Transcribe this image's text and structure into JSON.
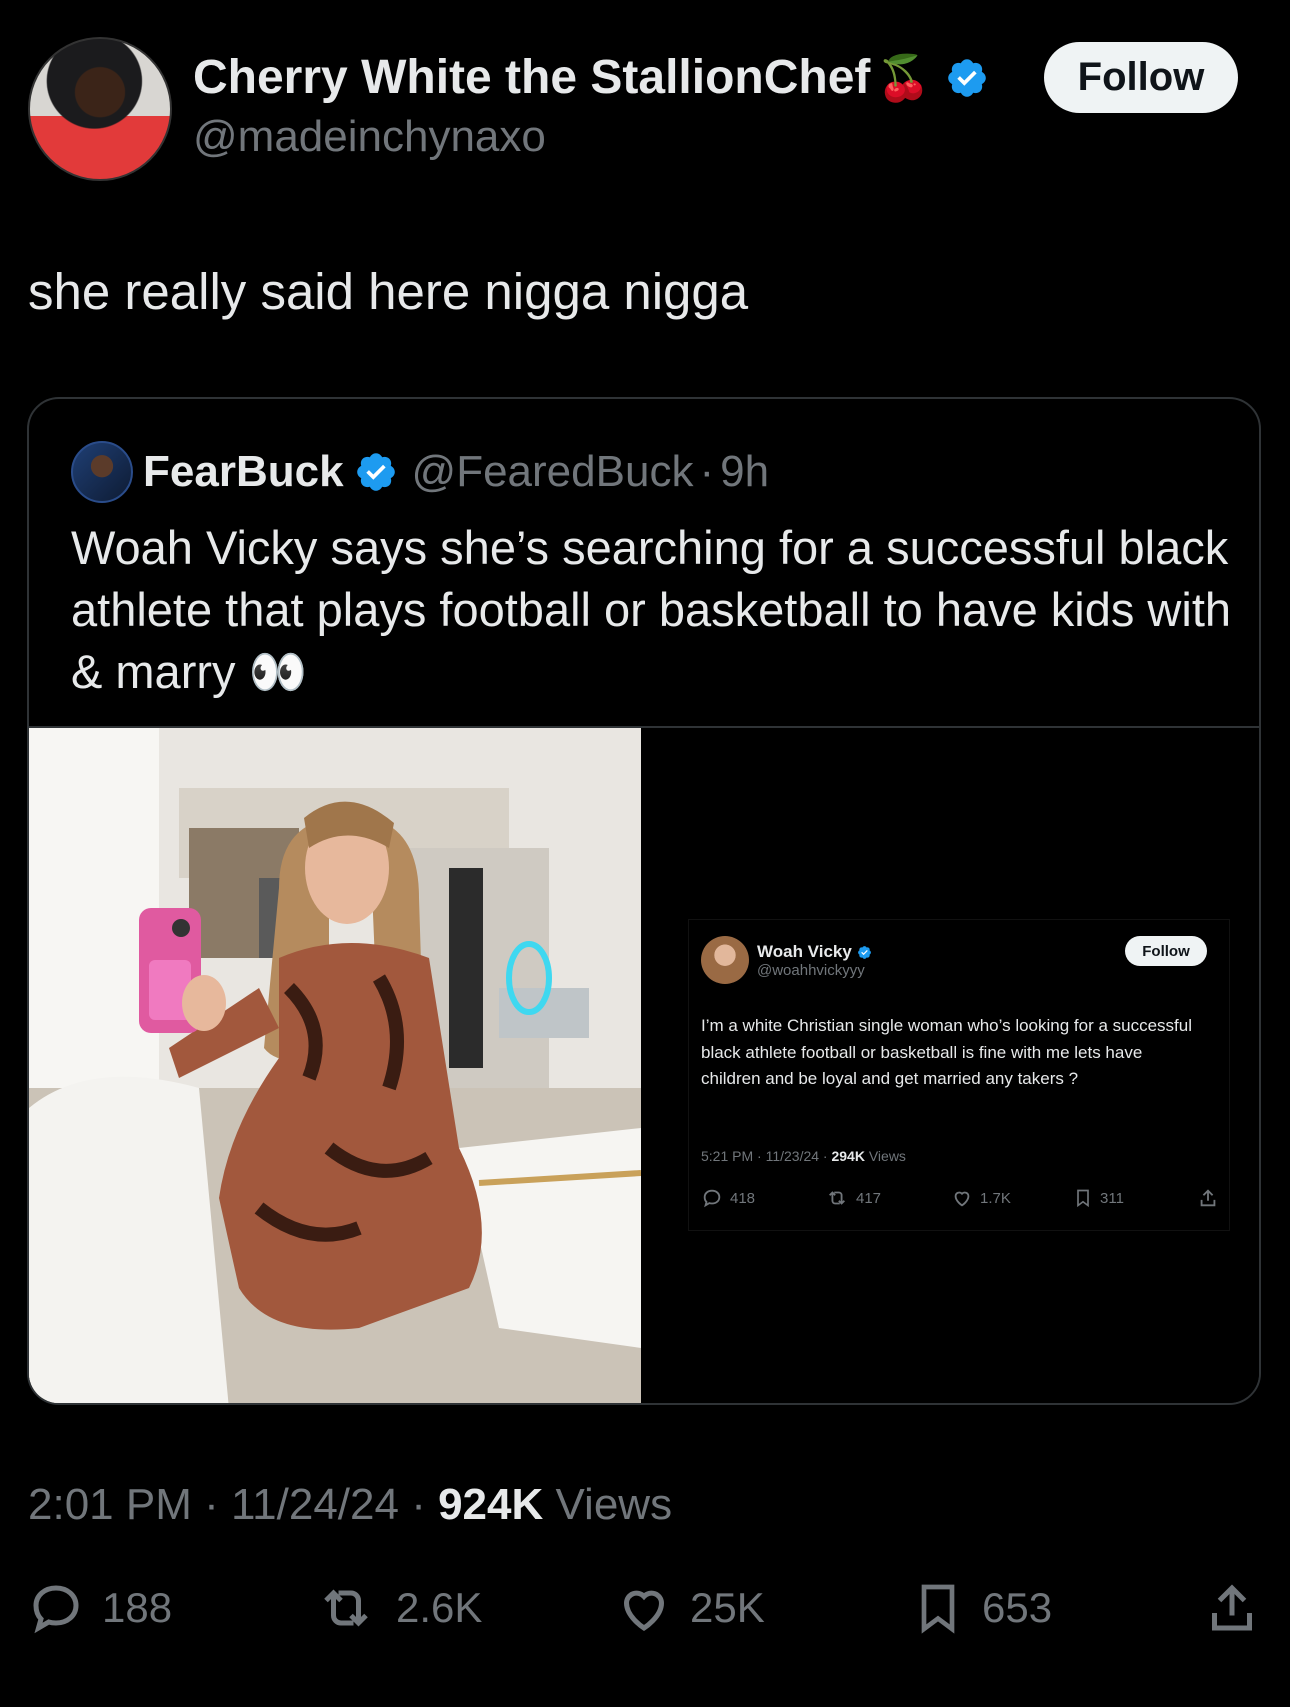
{
  "author": {
    "display_name": "Cherry White the StallionChef",
    "name_emoji": "🍒",
    "handle": "@madeinchynaxo",
    "follow_label": "Follow"
  },
  "tweet": {
    "text": "she really said here nigga nigga"
  },
  "quoted": {
    "name": "FearBuck",
    "handle": "@FearedBuck",
    "separator": "·",
    "age": "9h",
    "text": "Woah Vicky says she’s searching for a successful black athlete that plays football or basketball to have kids with & marry 👀"
  },
  "embedded": {
    "name": "Woah Vicky",
    "handle": "@woahhvickyyy",
    "follow_label": "Follow",
    "text": "I’m a white Christian single woman who’s looking for a successful black   athlete football or basketball is fine with me lets have children and be loyal and get married any takers ?",
    "meta_time": "5:21 PM · 11/23/24 · ",
    "meta_views": "294K",
    "meta_views_label": " Views",
    "replies": "418",
    "reposts": "417",
    "likes": "1.7K",
    "bookmarks": "311"
  },
  "footer": {
    "time": "2:01 PM · 11/24/24 · ",
    "views": "924K",
    "views_label": " Views",
    "replies": "188",
    "reposts": "2.6K",
    "likes": "25K",
    "bookmarks": "653"
  },
  "colors": {
    "background": "#000000",
    "text": "#e7e9ea",
    "muted": "#71767b",
    "verified": "#1d9bf0",
    "border": "#2f3336"
  }
}
